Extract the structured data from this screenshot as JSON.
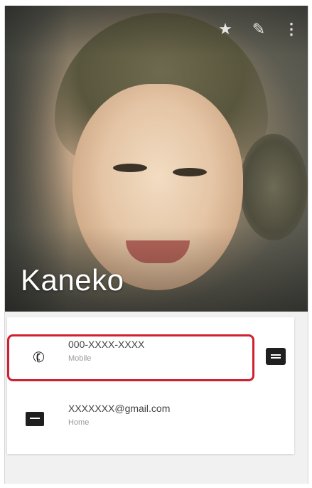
{
  "header": {
    "actions": {
      "star_icon": "star-icon",
      "edit_icon": "pencil-icon",
      "more_icon": "more-vert-icon"
    },
    "contact_name": "Kaneko"
  },
  "details": {
    "phone": {
      "icon": "phone-icon",
      "number": "000-XXXX-XXXX",
      "type": "Mobile",
      "message_icon": "message-icon"
    },
    "email": {
      "icon": "email-icon",
      "address": "XXXXXXX@gmail.com",
      "type": "Home"
    }
  },
  "colors": {
    "highlight": "#d01f2e",
    "name_text": "#ffffff"
  }
}
